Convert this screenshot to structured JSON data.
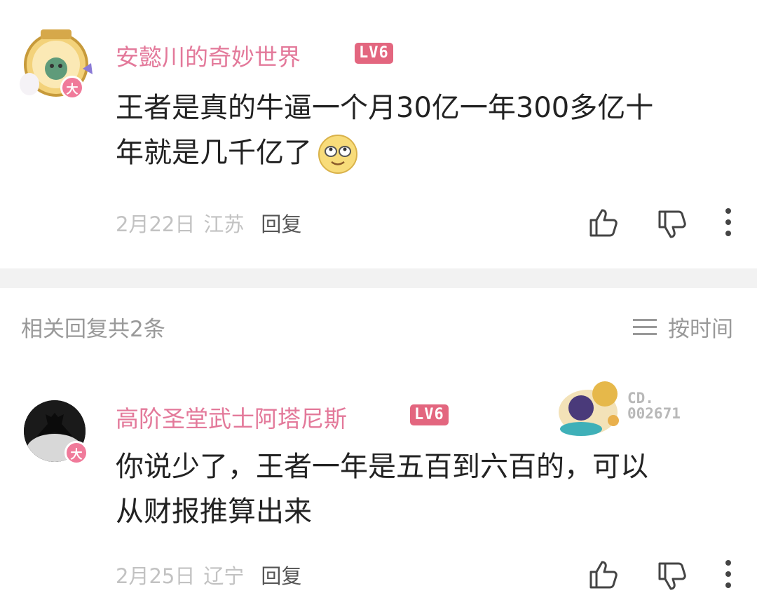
{
  "comments": [
    {
      "username": "安懿川的奇妙世界",
      "level": "LV6",
      "avatar_badge": "大",
      "text_line1": "王者是真的牛逼一个月30亿一年300多亿十",
      "text_line2": "年就是几千亿了",
      "emoji": "smile-emoji",
      "date": "2月22日",
      "location": "江苏",
      "reply_label": "回复"
    },
    {
      "username": "高阶圣堂武士阿塔尼斯",
      "level": "LV6",
      "avatar_badge": "大",
      "text_line1": "你说少了，王者一年是五百到六百的，可以",
      "text_line2": "从财报推算出来",
      "date": "2月25日",
      "location": "辽宁",
      "reply_label": "回复",
      "fan_badge_prefix": "CD.",
      "fan_badge_number": "002671"
    }
  ],
  "replies_header": "相关回复共2条",
  "sort_label": "按时间",
  "colors": {
    "username": "#e3799a",
    "level_bg": "#e3667f",
    "meta": "#c2c2c2",
    "divider": "#f2f2f2"
  },
  "icons": [
    "like-icon",
    "dislike-icon",
    "more-icon",
    "sort-icon"
  ]
}
